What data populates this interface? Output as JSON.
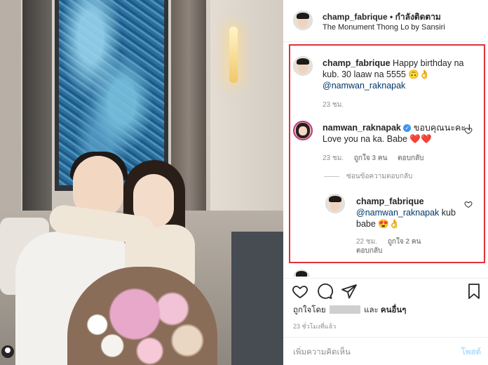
{
  "header": {
    "username": "champ_fabrique",
    "separator": "•",
    "follow_label": "กำลังติดตาม",
    "location": "The Monument Thong Lo by Sansiri"
  },
  "comments": [
    {
      "username": "champ_fabrique",
      "text": "Happy birthday na kub. 30 laaw na 5555 🙃👌",
      "mention": "@namwan_raknapak",
      "time": "23 ชม."
    },
    {
      "username": "namwan_raknapak",
      "verified": true,
      "text": "ขอบคุณนะคะ I Love you na ka. Babe ❤️❤️",
      "time": "23 ชม.",
      "likes": "ถูกใจ 3 คน",
      "reply_label": "ตอบกลับ"
    }
  ],
  "hide_replies_label": "ซ่อนข้อความตอบกลับ",
  "reply": {
    "username": "champ_fabrique",
    "mention": "@namwan_raknapak",
    "text": "kub babe 😍👌",
    "time": "22 ชม.",
    "likes": "ถูกใจ 2 คน",
    "reply_label": "ตอบกลับ"
  },
  "liked_by": {
    "prefix": "ถูกใจโดย",
    "middle": "และ",
    "others": "คนอื่นๆ"
  },
  "time_ago": "23 ชั่วโมงที่แล้ว",
  "add_comment_placeholder": "เพิ่มความคิดเห็น",
  "post_label": "โพสต์",
  "colors": {
    "highlight": "#e0313b",
    "mention": "#00376b",
    "verified": "#3897f0",
    "muted": "#8e8e8e"
  }
}
